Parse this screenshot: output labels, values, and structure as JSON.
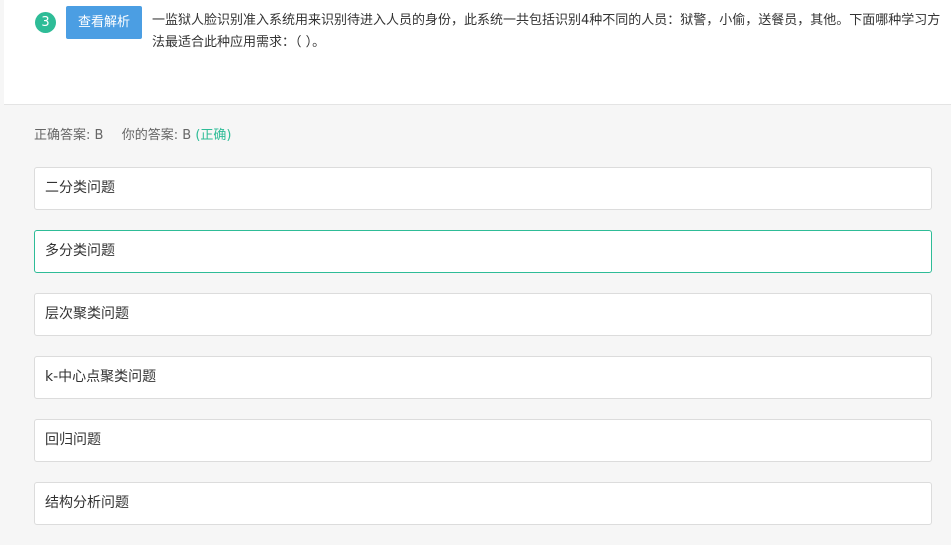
{
  "question": {
    "number": "3",
    "analysis_button_label": "查看解析",
    "text": "一监狱人脸识别准入系统用来识别待进入人员的身份，此系统一共包括识别4种不同的人员：狱警，小偷，送餐员，其他。下面哪种学习方法最适合此种应用需求：（ ）。"
  },
  "answer_summary": {
    "correct_label": "正确答案:",
    "correct_value": "B",
    "yours_label": "你的答案:",
    "yours_value": "B",
    "status": "(正确)"
  },
  "options": [
    {
      "label": "二分类问题",
      "selected": false
    },
    {
      "label": "多分类问题",
      "selected": true
    },
    {
      "label": "层次聚类问题",
      "selected": false
    },
    {
      "label": "k-中心点聚类问题",
      "selected": false
    },
    {
      "label": "回归问题",
      "selected": false
    },
    {
      "label": "结构分析问题",
      "selected": false
    }
  ],
  "colors": {
    "badge": "#2ebc97",
    "button": "#4b9ee3",
    "correct_status": "#2ebc97",
    "selected_border": "#2ebc97"
  }
}
